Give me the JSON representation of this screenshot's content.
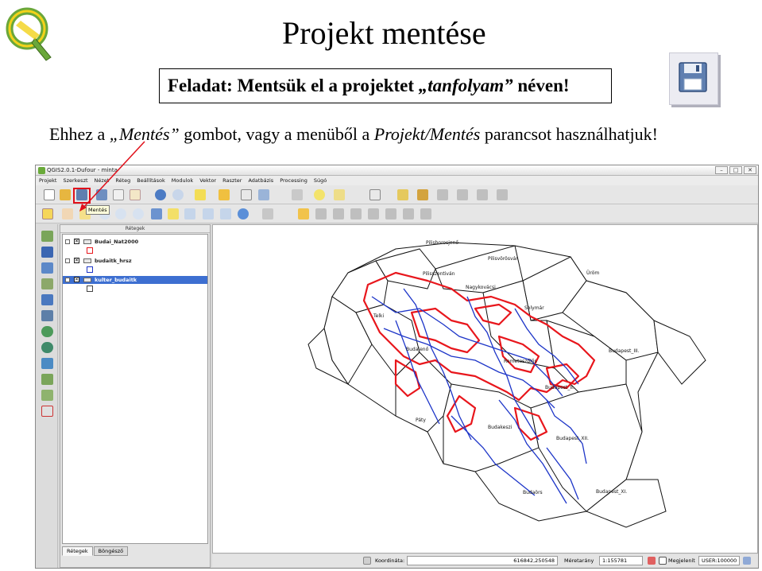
{
  "slide": {
    "title": "Projekt mentése",
    "task_label": "Feladat:",
    "task_text_before": " Mentsük el a projektet ",
    "task_name": "„tanfolyam”",
    "task_text_after": " néven!",
    "instruction_before": "Ehhez a ",
    "instruction_button": "„Mentés”",
    "instruction_middle": " gombot, vagy a menüből a ",
    "instruction_menu": "Projekt/Mentés",
    "instruction_after": " parancsot használhatjuk!"
  },
  "qgis": {
    "window_title": "QGIS2.0.1-Dufour - minta",
    "window_controls": [
      "–",
      "□",
      "✕"
    ],
    "menu": [
      "Projekt",
      "Szerkeszt",
      "Nézet",
      "Réteg",
      "Beállítások",
      "Modulok",
      "Vektor",
      "Raszter",
      "Adatbázis",
      "Processing",
      "Súgó"
    ],
    "tooltip": "Mentés",
    "layers_panel_title": "Rétegek",
    "layers": [
      {
        "name": "Budai_Nat2000",
        "selected": false
      },
      {
        "name": "budaitk_hrsz",
        "selected": false
      },
      {
        "name": "kulter_budaitk",
        "selected": true
      }
    ],
    "panel_tabs": [
      "Rétegek",
      "Böngésző"
    ],
    "map_labels": [
      "Pilisvörösvár",
      "Pilisszentiván",
      "Solymár",
      "Budapest_III.",
      "Budakeszi",
      "Budajenő",
      "Telki",
      "Páty",
      "Nagykovácsi",
      "Remeteszőlős",
      "Budapest_II.",
      "Budapest_XII.",
      "Budapest_XI.",
      "Budaörs",
      "Pilisborosjenő",
      "Üröm"
    ],
    "status": {
      "coord_label": "Koordináta:",
      "coord_value": "616842,250548",
      "scale_label": "Méretarány",
      "scale_value": "1:155781",
      "render_label": "Megjelenít",
      "crs": "USER:100000"
    }
  },
  "colors": {
    "highlight": "#e0101a",
    "selection": "#3d6fd1",
    "parcel_red": "#e8161c",
    "path_blue": "#1d35c8"
  }
}
